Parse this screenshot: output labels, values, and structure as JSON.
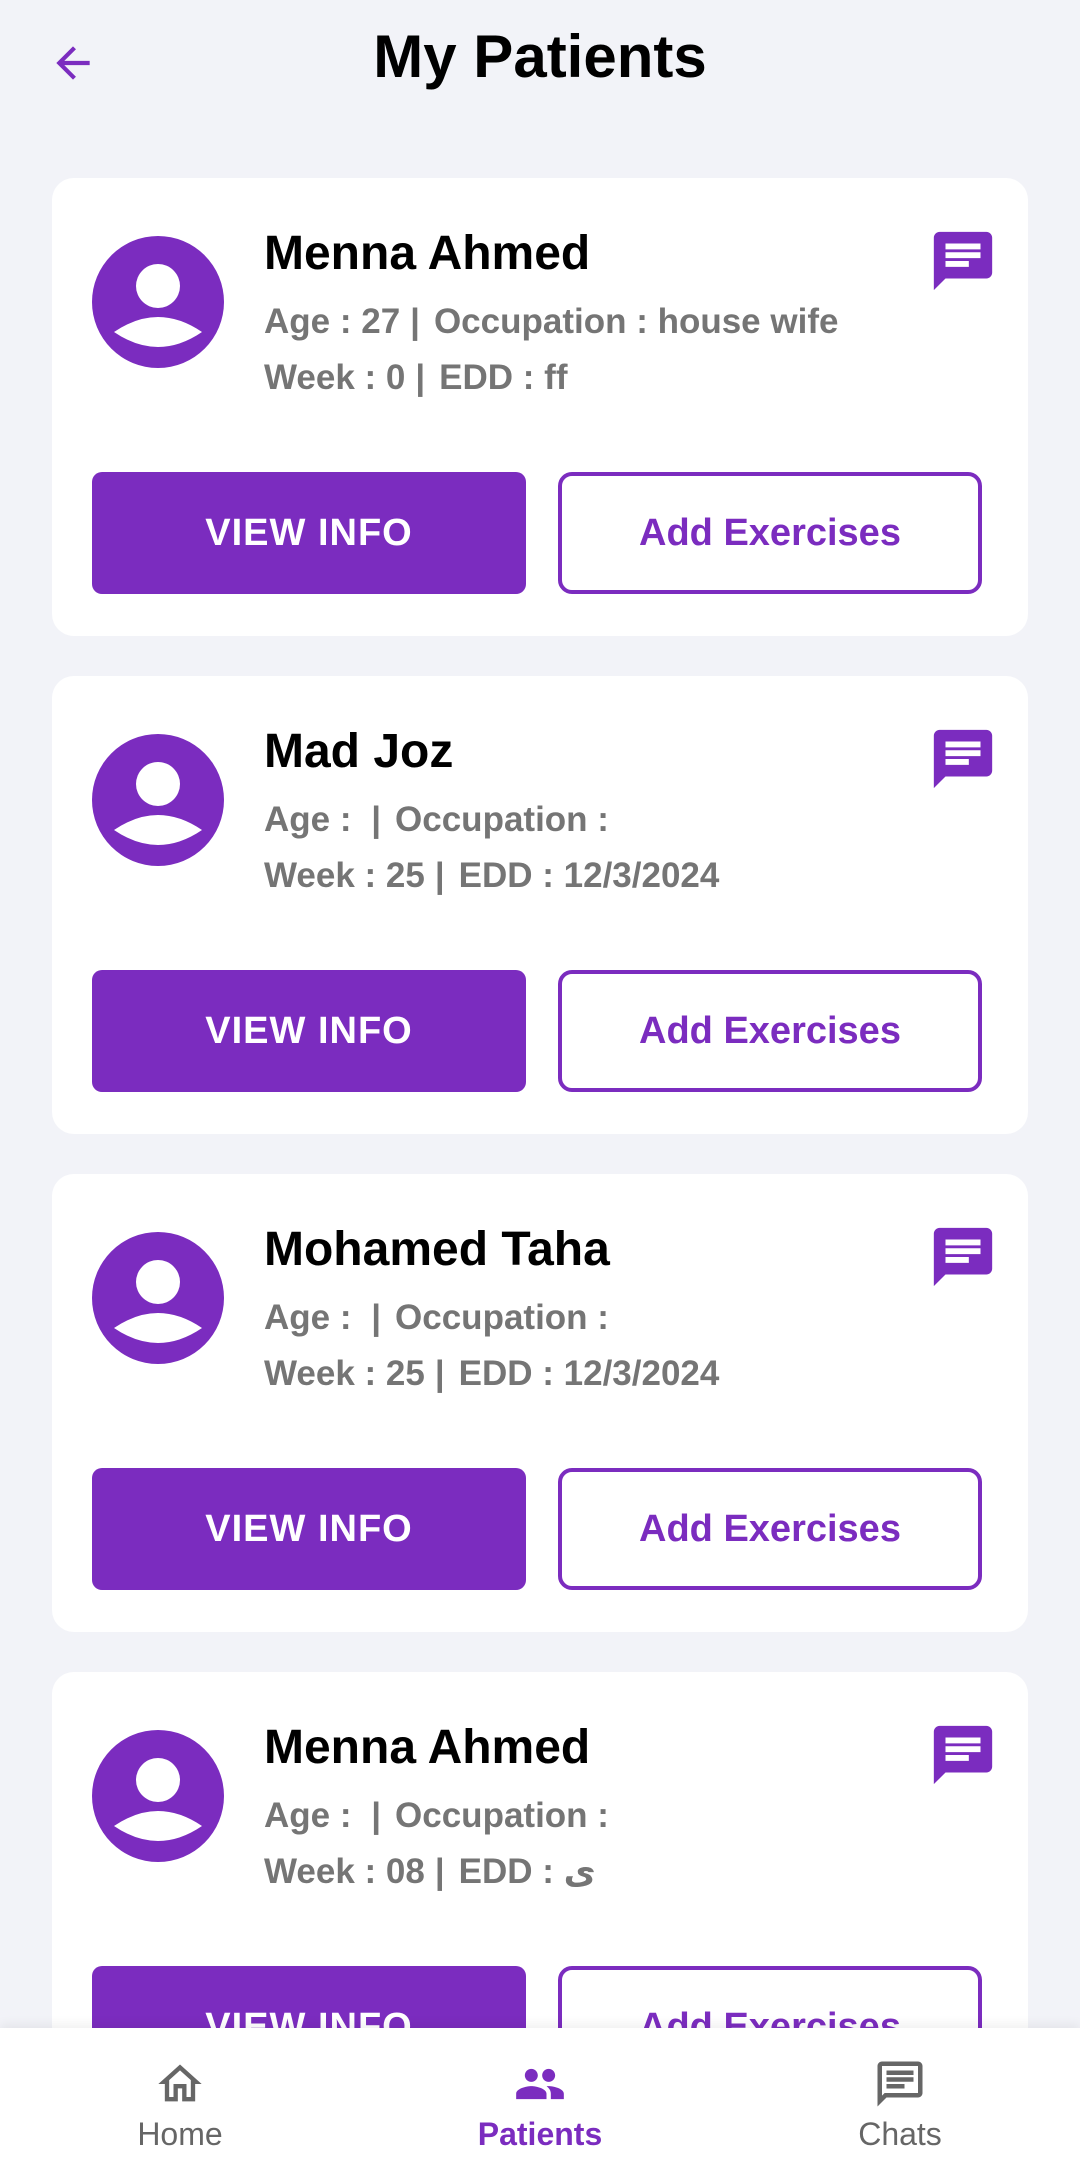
{
  "header": {
    "title": "My Patients",
    "back_icon": "arrow-left-icon"
  },
  "colors": {
    "accent": "#7b2cbf",
    "background": "#f2f3f8",
    "muted_text": "#757575"
  },
  "patients": [
    {
      "name": "Menna Ahmed",
      "age_label": "Age : 27",
      "occupation_label": "Occupation : house wife",
      "week_label": "Week : 0",
      "edd_label": "EDD :  ff",
      "view_label": "VIEW INFO",
      "add_label": "Add Exercises"
    },
    {
      "name": "Mad Joz",
      "age_label": "Age : ",
      "occupation_label": "Occupation :",
      "week_label": "Week : 25",
      "edd_label": "EDD :  12/3/2024",
      "view_label": "VIEW INFO",
      "add_label": "Add Exercises"
    },
    {
      "name": "Mohamed Taha",
      "age_label": "Age : ",
      "occupation_label": "Occupation :",
      "week_label": "Week : 25",
      "edd_label": "EDD :  12/3/2024",
      "view_label": "VIEW INFO",
      "add_label": "Add Exercises"
    },
    {
      "name": "Menna Ahmed",
      "age_label": "Age : ",
      "occupation_label": "Occupation :",
      "week_label": "Week : 08",
      "edd_label": "EDD :  ى",
      "view_label": "VIEW INFO",
      "add_label": "Add Exercises"
    }
  ],
  "separator": "|",
  "bottom_nav": {
    "items": [
      {
        "label": "Home",
        "icon": "home-icon"
      },
      {
        "label": "Patients",
        "icon": "patients-icon",
        "active": true
      },
      {
        "label": "Chats",
        "icon": "chat-icon"
      }
    ]
  }
}
